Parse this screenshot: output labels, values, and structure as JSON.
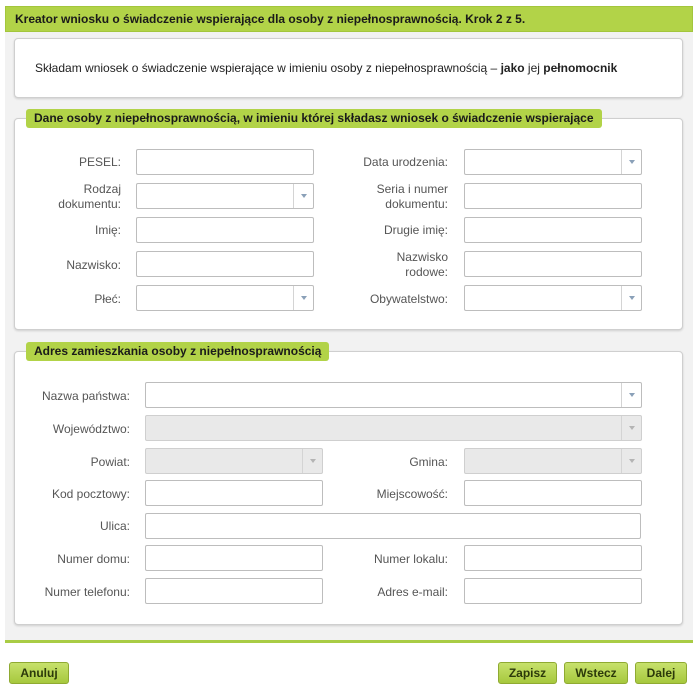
{
  "header": {
    "title": "Kreator wniosku o świadczenie wspierające dla osoby z niepełnosprawnością. Krok 2 z 5."
  },
  "intro": {
    "text_part1": "Składam wniosek o świadczenie wspierające  w imieniu osoby z niepełnosprawnością – ",
    "bold1": "jako",
    "text_part2": " jej ",
    "bold2": "pełnomocnik"
  },
  "person_section": {
    "legend": "Dane osoby z niepełnosprawnością, w imieniu której składasz wniosek o świadczenie wspierające",
    "labels": {
      "pesel": "PESEL:",
      "doc_type": "Rodzaj dokumentu:",
      "first_name": "Imię:",
      "last_name": "Nazwisko:",
      "sex": "Płeć:",
      "birth_date": "Data urodzenia:",
      "doc_number": "Seria i numer dokumentu:",
      "second_name": "Drugie imię:",
      "family_name": "Nazwisko rodowe:",
      "citizenship": "Obywatelstwo:"
    }
  },
  "address_section": {
    "legend": "Adres zamieszkania osoby z niepełnosprawnością",
    "labels": {
      "country": "Nazwa państwa:",
      "voivodeship": "Województwo:",
      "county": "Powiat:",
      "commune": "Gmina:",
      "postal_code": "Kod pocztowy:",
      "city": "Miejscowość:",
      "street": "Ulica:",
      "house_no": "Numer domu:",
      "apartment_no": "Numer lokalu:",
      "phone": "Numer telefonu:",
      "email": "Adres e-mail:"
    }
  },
  "buttons": {
    "cancel": "Anuluj",
    "save": "Zapisz",
    "back": "Wstecz",
    "next": "Dalej"
  },
  "colors": {
    "accent": "#b2d348",
    "panel_bg": "#f2f2f2"
  }
}
